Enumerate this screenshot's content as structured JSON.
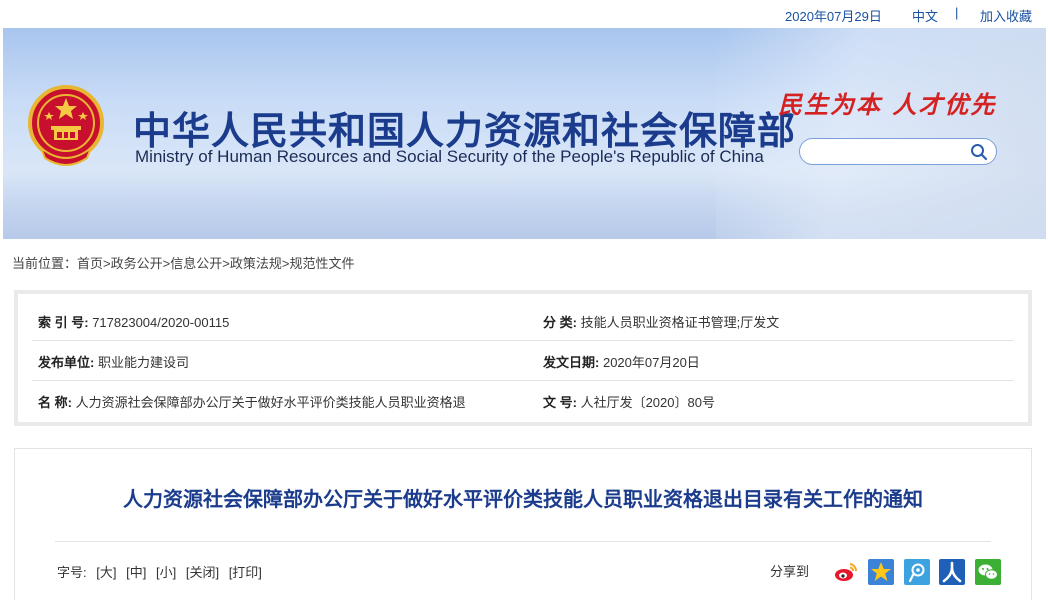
{
  "topbar": {
    "date": "2020年07月29日",
    "lang": "中文",
    "separator": "|",
    "favorite": "加入收藏"
  },
  "banner": {
    "title_cn": "中华人民共和国人力资源和社会保障部",
    "title_en": "Ministry of Human Resources and Social Security of the People's Republic of China",
    "slogan": "民生为本 人才优先",
    "search_placeholder": ""
  },
  "breadcrumb": {
    "prefix": "当前位置：",
    "items": [
      "首页",
      "政务公开",
      "信息公开",
      "政策法规",
      "规范性文件"
    ],
    "sep": ">"
  },
  "info": {
    "index_label": "索 引 号:",
    "index_value": "717823004/2020-00115",
    "category_label": "分 类:",
    "category_value": "技能人员职业资格证书管理;厅发文",
    "publisher_label": "发布单位:",
    "publisher_value": "职业能力建设司",
    "date_label": "发文日期:",
    "date_value": "2020年07月20日",
    "name_label": "名 称:",
    "name_value": "人力资源社会保障部办公厅关于做好水平评价类技能人员职业资格退",
    "docno_label": "文 号:",
    "docno_value": "人社厅发〔2020〕80号"
  },
  "article": {
    "title": "人力资源社会保障部办公厅关于做好水平评价类技能人员职业资格退出目录有关工作的通知",
    "font_label": "字号:",
    "opt_large": "[大]",
    "opt_medium": "[中]",
    "opt_small": "[小]",
    "opt_close": "[关闭]",
    "opt_print": "[打印]",
    "share_label": "分享到"
  },
  "colors": {
    "brand_blue": "#1b3c8c",
    "slogan_red": "#d42222",
    "link_blue": "#1a52a0"
  },
  "icons": [
    "national-emblem",
    "search-icon",
    "weibo-icon",
    "qzone-icon",
    "tencent-weibo-icon",
    "renren-icon",
    "wechat-icon"
  ]
}
